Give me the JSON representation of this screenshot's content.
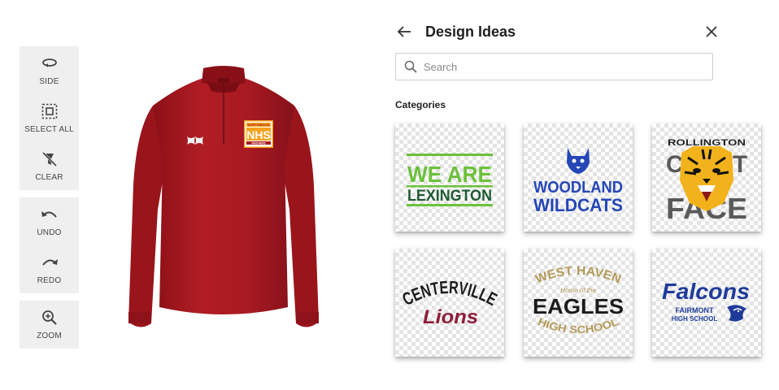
{
  "toolbar": {
    "side_label": "SIDE",
    "select_all_label": "SELECT ALL",
    "clear_label": "CLEAR",
    "undo_label": "UNDO",
    "redo_label": "REDO",
    "zoom_label": "ZOOM"
  },
  "product": {
    "shirt_color": "#a8161e",
    "chest_logo": {
      "top": "NORTHWOOD",
      "main": "NHS",
      "bottom": "PANTHERS"
    }
  },
  "panel": {
    "title": "Design Ideas",
    "search_placeholder": "Search",
    "categories_label": "Categories"
  },
  "designs": [
    {
      "line1": "WE ARE",
      "line2": "LEXINGTON"
    },
    {
      "line1": "WOODLAND",
      "line2": "WILDCATS"
    },
    {
      "line1": "ROLLINGTON",
      "line2": "CREST",
      "line3": "FACE"
    },
    {
      "line1": "CENTERVILLE",
      "line2": "Lions"
    },
    {
      "line1": "WEST HAVEN",
      "line2": "Home of the",
      "line3": "EAGLES",
      "line4": "HIGH SCHOOL"
    },
    {
      "line1": "Falcons",
      "line2": "FAIRMONT",
      "line3": "HIGH SCHOOL"
    }
  ],
  "colors": {
    "accent_green": "#6cc13a",
    "dark_green": "#1f5a32",
    "blue": "#2446b6",
    "gold": "#b39a5a",
    "maroon": "#8e1d3b",
    "navy": "#1f3b9a"
  }
}
